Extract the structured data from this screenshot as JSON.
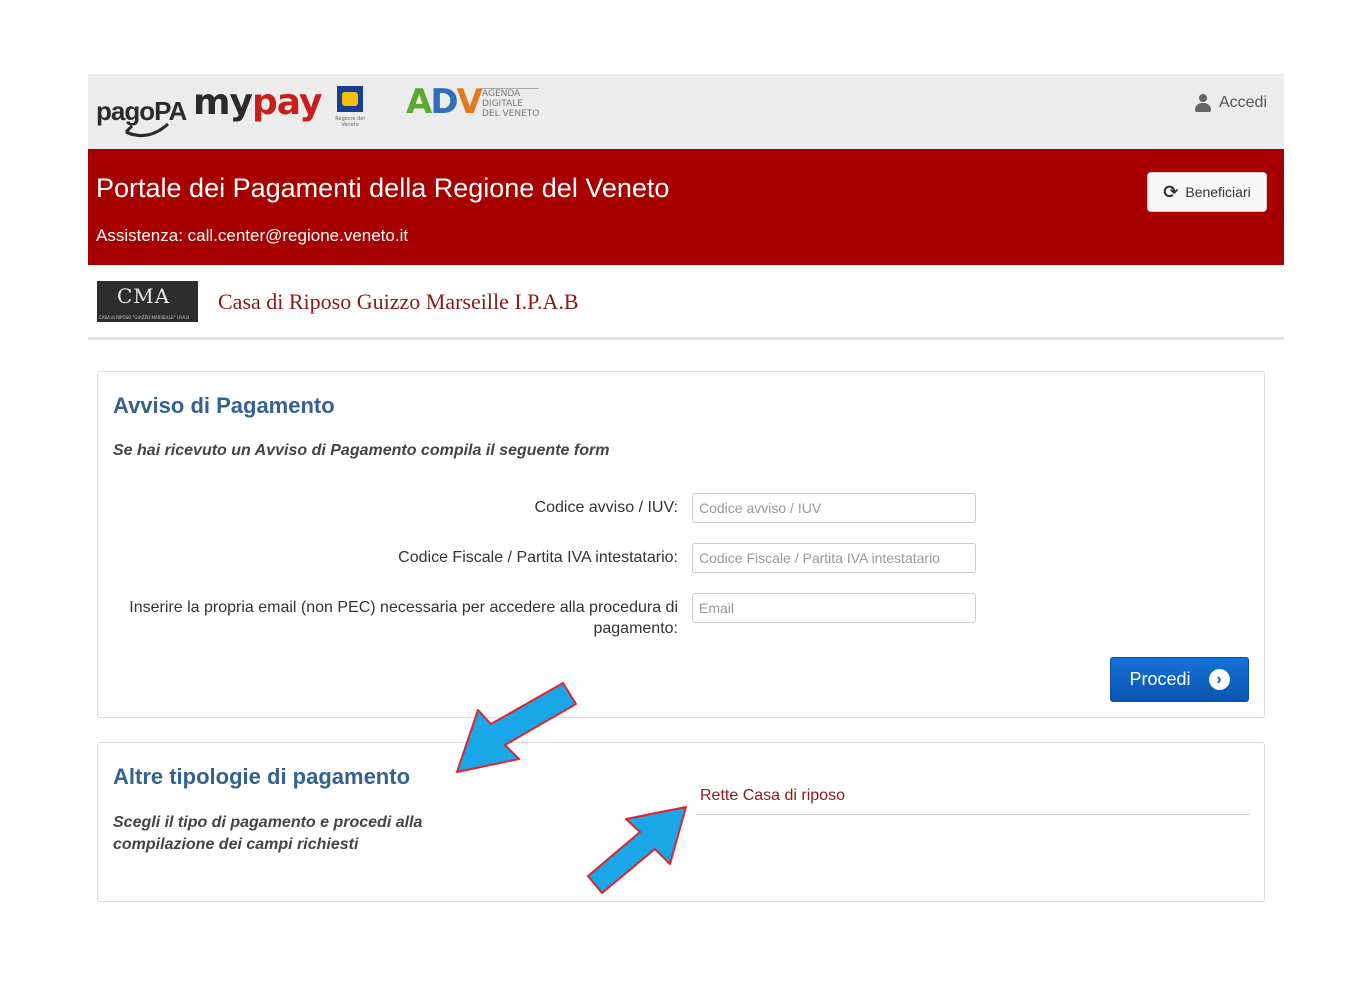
{
  "header": {
    "logos": {
      "pagopa": "pagoPA",
      "mypay_my": "my",
      "mypay_pay": "pay",
      "adv_mark": [
        "A",
        "D",
        "V"
      ],
      "adv_sub": "AGENDA\nDIGITALE\nDEL VENETO",
      "veneto_caption": "Regione del Veneto"
    },
    "login_label": "Accedi"
  },
  "banner": {
    "title": "Portale dei Pagamenti della Regione del Veneto",
    "assistance": "Assistenza: call.center@regione.veneto.it",
    "beneficiari_label": "Beneficiari"
  },
  "entity": {
    "logo_glyph": "CMA",
    "logo_caption": "CASA di RIPOSO \"GUIZZO MARSEILLE\" I.P.A.B",
    "name": "Casa di Riposo Guizzo Marseille I.P.A.B"
  },
  "avviso": {
    "title": "Avviso di Pagamento",
    "subtitle": "Se hai ricevuto un Avviso di Pagamento compila il seguente form",
    "fields": [
      {
        "label": "Codice avviso / IUV:",
        "placeholder": "Codice avviso / IUV",
        "value": ""
      },
      {
        "label": "Codice Fiscale / Partita IVA intestatario:",
        "placeholder": "Codice Fiscale / Partita IVA intestatario",
        "value": ""
      },
      {
        "label": "Inserire la propria email (non PEC) necessaria per accedere alla procedura di pagamento:",
        "placeholder": "Email",
        "value": ""
      }
    ],
    "submit_label": "Procedi"
  },
  "altre": {
    "title": "Altre tipologie di pagamento",
    "subtitle": "Scegli il tipo di pagamento e procedi alla compilazione dei campi richiesti",
    "options": [
      "Rette Casa di riposo"
    ]
  },
  "colors": {
    "banner": "#a80000",
    "heading": "#34618f",
    "link": "#8a1a1a",
    "primary_button": "#0a55b0",
    "annotation_arrow": "#1aa7e8",
    "annotation_outline": "#e0242b"
  }
}
